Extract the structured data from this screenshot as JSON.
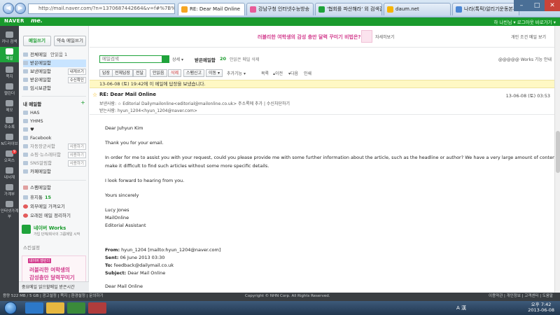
{
  "browser": {
    "address": "http://mail.naver.com/?n=1370687442664&v=f#%7B%22fClass%22%3A",
    "tabs": [
      {
        "label": "RE: Dear Mail Online",
        "active": true,
        "color": "#f5a623"
      },
      {
        "label": "강남구청 인터넷수능방송",
        "active": false,
        "color": "#e85c9a"
      },
      {
        "label": "'협회를 파산해라' 외 검색결...",
        "active": false,
        "color": "#1fa33b"
      },
      {
        "label": "daum.net",
        "active": false,
        "color": "#f6b400"
      },
      {
        "label": "나라(톡픽)알리기운동본부",
        "active": false,
        "color": "#4a86d4"
      }
    ]
  },
  "header": {
    "brand": "NAVER",
    "brand_me": "me.",
    "right_text": "하 나빈님 ▾   로그아웃   바로가기 ▾"
  },
  "rail": [
    {
      "label": "카나\n검색",
      "active": false
    },
    {
      "label": "메일",
      "active": true
    },
    {
      "label": "쪽지",
      "active": false
    },
    {
      "label": "캘린더",
      "active": false
    },
    {
      "label": "메모",
      "active": false
    },
    {
      "label": "주소록",
      "active": false
    },
    {
      "label": "N드라이브",
      "active": false
    },
    {
      "label": "오피스",
      "active": false,
      "badge": "9"
    },
    {
      "label": "내서재",
      "active": false
    },
    {
      "label": "가계부",
      "active": false
    },
    {
      "label": "인터넷가계부",
      "active": false
    }
  ],
  "sidebar": {
    "compose": "메일쓰기",
    "compose_note": "약속 메일쓰기",
    "top_folders": [
      {
        "label": "전체메일",
        "extra": "안읽음 1"
      },
      {
        "label": "받은메일함",
        "active": true
      },
      {
        "label": "보낸메일함",
        "btn": "내게쓰기"
      },
      {
        "label": "받은메일함",
        "btn": "수신확인"
      },
      {
        "label": "임시보관함"
      }
    ],
    "my_folders_title": "내 메일함",
    "my_folders": [
      {
        "label": "HAS"
      },
      {
        "label": "YHMS"
      },
      {
        "label": "♥"
      },
      {
        "label": "Facebook"
      },
      {
        "label": "자동장군서함",
        "btn": "사용하기"
      },
      {
        "label": "쇼핑·뉴스레터함",
        "btn": "사용하기"
      },
      {
        "label": "SNS알림함",
        "btn": "사용하기"
      },
      {
        "label": "카페메일함"
      }
    ],
    "spam": "스팸메일함",
    "trash": "휴지통",
    "trash_count": "15",
    "external": "외부메일 가져오기",
    "wrong_cleanup": "오래된 메일 정리하기",
    "works_title": "네이버 Works",
    "works_desc": "가입 단체/회사의 그룹메일 시작",
    "settings": "스킨설정",
    "promo_tag": "네이버 캘린더",
    "promo_line1": "러블리한 여학생의",
    "promo_line2": "감성충만 달력꾸미기",
    "bottom": "중요메일   읽으할메일   받은시간"
  },
  "banner": {
    "text": "러블리한 여학생의 감성 충만 달력 꾸미기 비법은?",
    "link": "자세히보기",
    "right": "개인 조건 메일 보기"
  },
  "search": {
    "placeholder": "메일검색",
    "option": "상세 ▾",
    "inbox_label": "받은메일함",
    "inbox_count": "20",
    "unread_note": "안읽은 메일 삭제",
    "right_note": "@@@@@ Works 기능 안내"
  },
  "toolbar": {
    "reply": "답장",
    "reply_all": "전체답장",
    "forward": "전달",
    "unread": "안읽음",
    "delete": "삭제",
    "spam": "스팸신고",
    "move": "이동 ▾",
    "more": "추가기능 ▾",
    "list": "목록",
    "prev": "▴이전",
    "next": "▾다음",
    "print": "인쇄"
  },
  "notice": "13-06-08 (토) 19:42에 이 메일에 답장을 보냈습니다.",
  "mail": {
    "subject": "RE: Dear Mail Online",
    "date": "13-06-08 (토) 03:53",
    "from": "보낸사람: ☆ Editorial Dailymailonline<editorial@mailonline.co.uk>  주소록에 추가  |  수신차단하기",
    "to": "받는사람: hyun_1204<hyun_1204@naver.com>",
    "body": [
      "Dear Juhyun Kim",
      "Thank you for your email.",
      "In order for me to assist you with your request, could you please provide me with some further information about the article, such as the headline or author? We have a very large amount of content which can",
      "make it difficult to find such articles without some more specific details.",
      "I look forward to hearing from you.",
      "Yours sincerely",
      "Lucy Jones",
      "MailOnline",
      "Editorial Assistant"
    ],
    "quote": {
      "from_label": "From:",
      "from_value": "hyun_1204 [mailto:hyun_1204@naver.com]",
      "sent_label": "Sent:",
      "sent_value": "06 June 2013 03:30",
      "to_label": "To:",
      "to_value": "feedback@dailymail.co.uk",
      "subject_label": "Subject:",
      "subject_value": "Dear Mail Online",
      "first_line": "Dear Mail Online"
    }
  },
  "status_bar": {
    "left": "용량 522 MB / 5 GB   |   광고설정   |   쪽지   |   환경설정   |   문의하기",
    "center": "Copyright © NHN Corp. All Rights Reserved.",
    "right": "이용약관   |   개인정보   |   고객센터   |   도움말"
  },
  "taskbar": {
    "time": "오후 7:42",
    "date": "2013-06-08",
    "lang": "A 漢"
  },
  "colors": {
    "naver_green": "#1a9b2d",
    "notice_yellow": "#fff8c4",
    "promo_pink": "#d23a8c"
  }
}
